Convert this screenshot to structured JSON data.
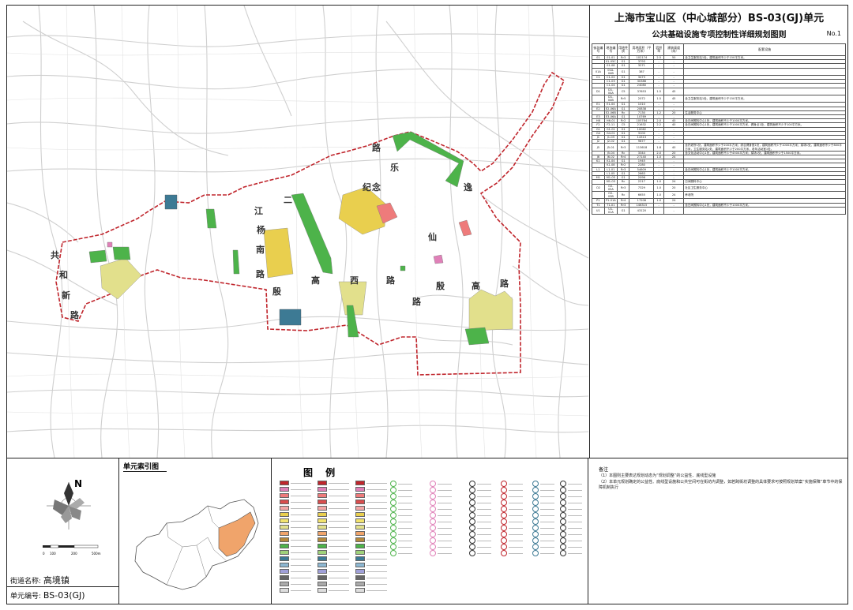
{
  "map": {
    "streets": [
      {
        "name": "street-label-1",
        "text": "路"
      },
      {
        "name": "street-label-2",
        "text": "乐"
      },
      {
        "name": "street-label-3",
        "text": "纪"
      },
      {
        "name": "street-label-4",
        "text": "念"
      },
      {
        "name": "street-label-5",
        "text": "二"
      },
      {
        "name": "street-label-6",
        "text": "江"
      },
      {
        "name": "street-label-7",
        "text": "杨"
      },
      {
        "name": "street-label-8",
        "text": "南"
      },
      {
        "name": "street-label-9",
        "text": "路"
      },
      {
        "name": "street-label-10",
        "text": "殷"
      },
      {
        "name": "street-label-11",
        "text": "高"
      },
      {
        "name": "street-label-12",
        "text": "西"
      },
      {
        "name": "street-label-13",
        "text": "路"
      },
      {
        "name": "street-label-14",
        "text": "仙"
      },
      {
        "name": "street-label-15",
        "text": "路"
      },
      {
        "name": "street-label-16",
        "text": "殷"
      },
      {
        "name": "street-label-17",
        "text": "高"
      },
      {
        "name": "street-label-18",
        "text": "路"
      },
      {
        "name": "street-label-19",
        "text": "共"
      },
      {
        "name": "street-label-20",
        "text": "和"
      },
      {
        "name": "street-label-21",
        "text": "新"
      },
      {
        "name": "street-label-22",
        "text": "路"
      },
      {
        "name": "street-label-23",
        "text": "逸"
      }
    ],
    "colors": {
      "boundary": "#c0262d",
      "yellow": "#e9cf4e",
      "green": "#4db34a",
      "blue": "#3d7a94",
      "pink": "#ee7b7b",
      "lightyellow": "#e2e08c",
      "magenta": "#e080b8",
      "road": "#cfcfcf"
    }
  },
  "panel": {
    "title": "上海市宝山区（中心城部分）BS-03(GJ)单元",
    "subtitle": "公共基础设施专项控制性详细规划图则",
    "sheet_no": "No.1",
    "headers": [
      "街坊编号",
      "地块编号",
      "用地性质",
      "用地面积（平方米）",
      "容积率",
      "建筑高度（米）",
      "配套设施"
    ],
    "rows": [
      [
        "01",
        "01-01",
        "Rr3",
        "102174",
        "2.5",
        "50",
        "含卫生服务站1处，建筑面积不少于150平方米。"
      ],
      [
        "",
        "01-05C",
        "G1",
        "3793",
        "-",
        "-",
        ""
      ],
      [
        "",
        "01-08",
        "G1",
        "3271",
        "-",
        "-",
        ""
      ],
      [
        "01A",
        "01A-04B",
        "G1",
        "387",
        "-",
        "-",
        ""
      ],
      [
        "C1",
        "C1-02",
        "G1",
        "3473",
        "-",
        "-",
        ""
      ],
      [
        "",
        "C1-03",
        "G1",
        "30386",
        "-",
        "-",
        ""
      ],
      [
        "",
        "C1-04",
        "G1",
        "24080",
        "-",
        "-",
        ""
      ],
      [
        "D1",
        "D1-04A",
        "C5",
        "37653",
        "1.5",
        "45",
        ""
      ],
      [
        "",
        "D1-04B",
        "Rr5",
        "2072",
        "1.5",
        "45",
        "含卫生服务站1处，建筑面积不少于150平方米。"
      ],
      [
        "E1",
        "E1-04",
        "G1",
        "1010",
        "-",
        "-",
        ""
      ],
      [
        "E2",
        "E2-06A",
        "G1",
        "20838",
        "-",
        "-",
        ""
      ],
      [
        "",
        "E2-06B",
        "Rc",
        "7130",
        "1.2",
        "20",
        "生活服务中心"
      ],
      [
        "E3",
        "E3-06A",
        "G1",
        "10769",
        "-",
        "-",
        ""
      ],
      [
        "H6",
        "H6-01",
        "Rr2",
        "105784",
        "2.0",
        "40",
        "含日间照料中心1处，建筑面积不少于1000平方米。"
      ],
      [
        "F2",
        "F2-11",
        "C5",
        "21632",
        "2.2",
        "40",
        "含日间照料中心1处，建筑面积不少于1000平方米，健身点1处，建筑面积不少于100平方米。"
      ],
      [
        "G1",
        "G1-01",
        "G1",
        "10062",
        "-",
        "-",
        ""
      ],
      [
        "G4",
        "G4-01",
        "G1",
        "3100",
        "-",
        "-",
        ""
      ],
      [
        "J1",
        "J1-03",
        "G1",
        "14313",
        "-",
        "-",
        ""
      ],
      [
        "J2",
        "J2-02",
        "G1",
        "9877",
        "-",
        "-",
        ""
      ],
      [
        "J5",
        "J5-01",
        "Rr3",
        "113618",
        "1.8",
        "40",
        "含托老所1处，建筑面积不少于200平方米；综合健身馆1处，建筑面积不少于1000平方米；菜场1处，建筑面积不少于800平方米，卫生服务站1处，建筑面积不少于200平方米，老年活动室1处。"
      ],
      [
        "",
        "J5-04",
        "Rc",
        "3344",
        "2.0",
        "20",
        "含文化活动中心1处，建筑面积不少于4500平方米；菜场1处，建筑面积不少于1500平方米。"
      ],
      [
        "J6",
        "J6-02",
        "Rr4",
        "27140",
        "1.0",
        "24",
        ""
      ],
      [
        "K1",
        "K1-04",
        "G1",
        "1945",
        "-",
        "-",
        ""
      ],
      [
        "",
        "K1-08",
        "Rr2",
        "2280",
        "-",
        "-",
        ""
      ],
      [
        "L1",
        "L1-01",
        "Rr3",
        "54609",
        "-",
        "-",
        "含日间照料中心1处，建筑面积不少于1000平方米。"
      ],
      [
        "",
        "L1-05",
        "G1",
        "2663",
        "-",
        "-",
        ""
      ],
      [
        "M1",
        "M1-05",
        "G1",
        "2096",
        "-",
        "-",
        ""
      ],
      [
        "",
        "M1-03",
        "Rc",
        "2217",
        "1.0",
        "24",
        "日间照料中心"
      ],
      [
        "O2",
        "O2-05A",
        "Rr3",
        "7329",
        "1.0",
        "20",
        "社区卫生服务中心"
      ],
      [
        "",
        "O2-03B",
        "Rc",
        "6655",
        "1.0",
        "24",
        "养老院"
      ],
      [
        "P1",
        "P1-01A",
        "Rr4",
        "17206",
        "1.0",
        "24",
        ""
      ],
      [
        "T1",
        "T1-01",
        "Rr3",
        "146315",
        "-",
        "-",
        "含日间照料中心1处，建筑面积不少于1000平方米。"
      ],
      [
        "U1",
        "U1-01A",
        "G1",
        "43120",
        "-",
        "-",
        ""
      ]
    ]
  },
  "bottom": {
    "compass_label": "N",
    "scale_labels": [
      "0",
      "100",
      "200",
      "500m"
    ],
    "street_name_label": "街道名称:",
    "street_name_value": "高境镇",
    "unit_no_label": "单元编号:",
    "unit_no_value": "BS-03(GJ)",
    "index_title": "单元索引图",
    "legend_title": "图 例",
    "notes_title": "备注",
    "notes": [
      "（1）本图则主要表达规划动态为“规划调整”的公益性、底线型设施",
      "（2）本单元规划确定的公益性、底线型设施和公共空间可在街坊内调整，如若跨街坊调整的具体要求可按照规划草案“实施保障”章节中的保障机制执行"
    ]
  }
}
